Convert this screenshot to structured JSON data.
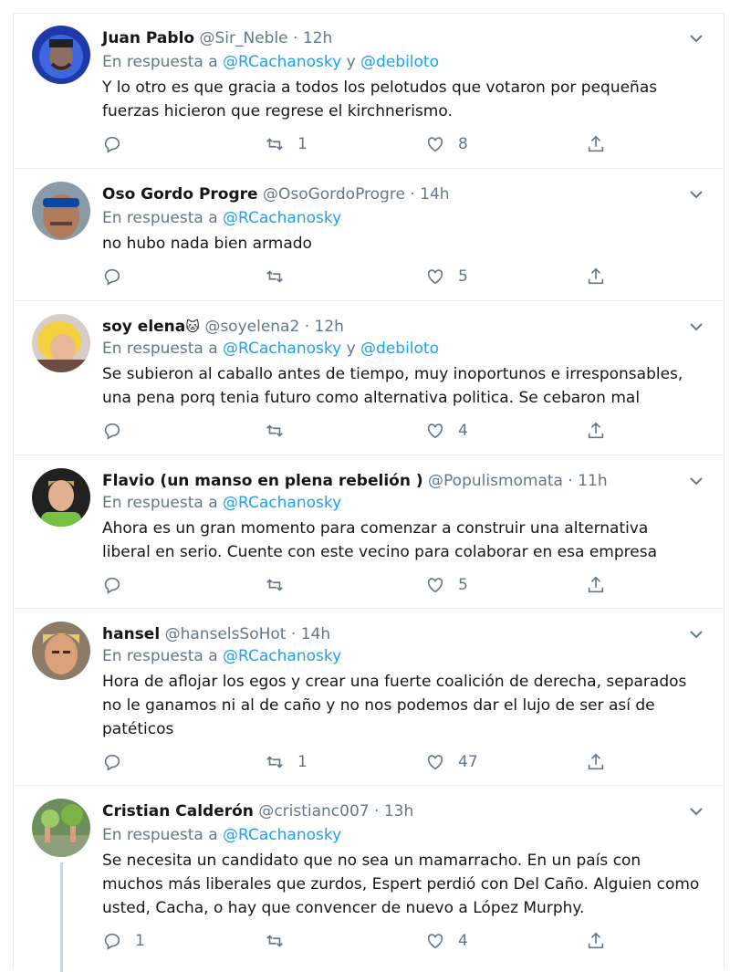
{
  "tweets": [
    {
      "name": "Juan Pablo",
      "handle": "@Sir_Neble",
      "time": "12h",
      "reply_prefix": "En respuesta a",
      "mentions": [
        "@RCachanosky",
        "@debiloto"
      ],
      "conj": "y",
      "text": "Y lo otro es que gracia a todos los pelotudos que votaron por pequeñas fuerzas hicieron que regrese el kirchnerismo.",
      "replies": "",
      "retweets": "1",
      "likes": "8"
    },
    {
      "name": "Oso Gordo Progre",
      "handle": "@OsoGordoProgre",
      "time": "14h",
      "reply_prefix": "En respuesta a",
      "mentions": [
        "@RCachanosky"
      ],
      "text": "no hubo nada bien armado",
      "replies": "",
      "retweets": "",
      "likes": "5"
    },
    {
      "name": "soy elena",
      "emoji": "🐱",
      "handle": "@soyelena2",
      "time": "12h",
      "reply_prefix": "En respuesta a",
      "mentions": [
        "@RCachanosky",
        "@debiloto"
      ],
      "conj": "y",
      "text": "Se subieron al caballo antes de tiempo, muy inoportunos e irresponsables, una pena porq tenia futuro como alternativa politica. Se cebaron mal",
      "replies": "",
      "retweets": "",
      "likes": "4"
    },
    {
      "name": "Flavio (un manso en plena rebelión )",
      "handle": "@Populismomata",
      "time": "11h",
      "reply_prefix": "En respuesta a",
      "mentions": [
        "@RCachanosky"
      ],
      "text": "Ahora es un gran momento para comenzar a construir una alternativa liberal en serio. Cuente con este vecino para colaborar en esa empresa",
      "replies": "",
      "retweets": "",
      "likes": "5"
    },
    {
      "name": "hansel",
      "handle": "@hanselsSoHot",
      "time": "14h",
      "reply_prefix": "En respuesta a",
      "mentions": [
        "@RCachanosky"
      ],
      "text": "Hora de aflojar los egos y crear una fuerte coalición de derecha, separados no le ganamos ni al de caño y no nos podemos dar el lujo de ser así de patéticos",
      "replies": "",
      "retweets": "1",
      "likes": "47"
    },
    {
      "name": "Cristian Calderón",
      "handle": "@cristianc007",
      "time": "13h",
      "reply_prefix": "En respuesta a",
      "mentions": [
        "@RCachanosky"
      ],
      "text": "Se necesita un candidato que no sea un mamarracho. En un país con muchos más liberales que zurdos, Espert perdió con Del Caño. Alguien como usted, Cacha, o hay que convencer de nuevo a López Murphy.",
      "replies": "1",
      "retweets": "",
      "likes": "4"
    }
  ],
  "separator": "·",
  "colors": {
    "link": "#1da1f2",
    "muted": "#657786",
    "text": "#14171a",
    "border": "#e6ecf0"
  }
}
